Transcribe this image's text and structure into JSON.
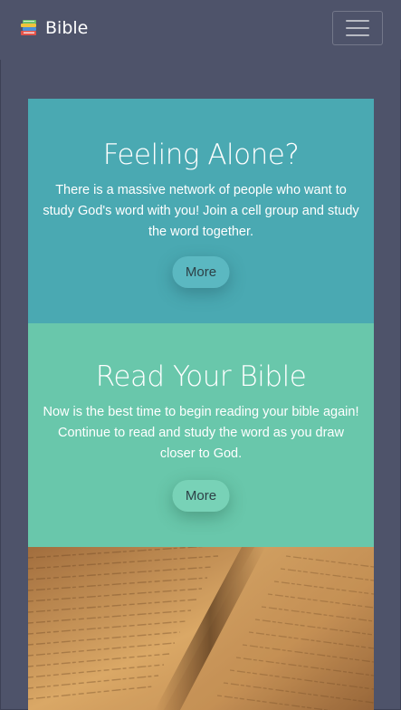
{
  "navbar": {
    "brand_label": "Bible",
    "brand_icon": "books-icon",
    "toggler_icon": "hamburger-menu-icon"
  },
  "cards": [
    {
      "title": "Feeling Alone?",
      "text": "There is a massive network of people who want to study God's word with you! Join a cell group and study the word together.",
      "button_label": "More",
      "color": "#4aa9b2"
    },
    {
      "title": "Read Your Bible",
      "text": "Now is the best time to begin reading your bible again! Continue to read and study the word as you draw closer to God.",
      "button_label": "More",
      "color": "#69c7ab"
    }
  ],
  "image": {
    "subject": "open-bible-photo"
  },
  "colors": {
    "background": "#4e536a",
    "text": "#ffffff"
  }
}
